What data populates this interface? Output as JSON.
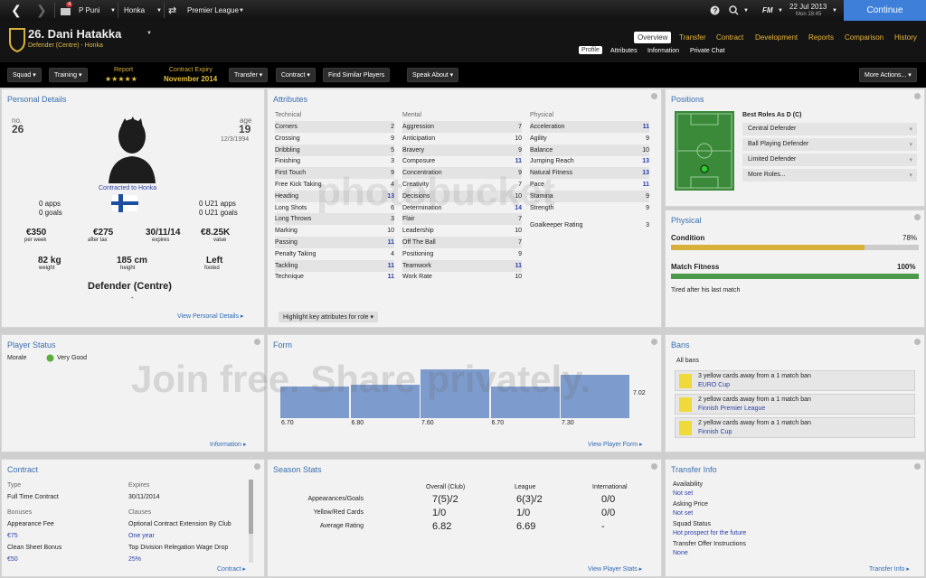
{
  "topbar": {
    "manager": "P Puni",
    "club": "Honka",
    "league": "Premier League",
    "date": "22 Jul 2013",
    "day_time": "Mon 18:45",
    "continue": "Continue",
    "badge": "4",
    "fm": "FM"
  },
  "player": {
    "name": "26. Dani Hatakka",
    "subtitle": "Defender (Centre) - Honka"
  },
  "nav": {
    "tabs": [
      "Overview",
      "Transfer",
      "Contract",
      "Development",
      "Reports",
      "Comparison",
      "History"
    ],
    "subtabs": [
      "Profile",
      "Attributes",
      "Information",
      "Private Chat"
    ]
  },
  "actions": {
    "squad": "Squad",
    "training": "Training",
    "report_label": "Report",
    "stars": "★★★★★",
    "contract_expiry_label": "Contract Expiry",
    "contract_expiry": "November 2014",
    "transfer": "Transfer",
    "contract": "Contract",
    "find_similar": "Find Similar Players",
    "speak_about": "Speak About",
    "more_actions": "More Actions..."
  },
  "personal": {
    "title": "Personal Details",
    "no_label": "no.",
    "no": "26",
    "age_label": "age",
    "age": "19",
    "dob": "12/3/1994",
    "contracted_to": "Contracted to Honka",
    "apps": "0 apps",
    "goals": "0 goals",
    "u21_apps": "0 U21 apps",
    "u21_goals": "0 U21 goals",
    "wage": "€350",
    "wage_label": "per week",
    "after_tax": "€275",
    "after_tax_label": "after tax",
    "expires": "30/11/14",
    "expires_label": "expires",
    "value": "€8.25K",
    "value_label": "value",
    "weight": "82 kg",
    "weight_label": "weight",
    "height": "185 cm",
    "height_label": "height",
    "foot": "Left",
    "foot_label": "footed",
    "position": "Defender (Centre)",
    "dash": "-",
    "link": "View Personal Details"
  },
  "attributes": {
    "title": "Attributes",
    "technical_label": "Technical",
    "mental_label": "Mental",
    "physical_label": "Physical",
    "technical": [
      [
        "Corners",
        "2"
      ],
      [
        "Crossing",
        "9"
      ],
      [
        "Dribbling",
        "5"
      ],
      [
        "Finishing",
        "3"
      ],
      [
        "First Touch",
        "9"
      ],
      [
        "Free Kick Taking",
        "4"
      ],
      [
        "Heading",
        "13"
      ],
      [
        "Long Shots",
        "6"
      ],
      [
        "Long Throws",
        "3"
      ],
      [
        "Marking",
        "10"
      ],
      [
        "Passing",
        "11"
      ],
      [
        "Penalty Taking",
        "4"
      ],
      [
        "Tackling",
        "11"
      ],
      [
        "Technique",
        "11"
      ]
    ],
    "mental": [
      [
        "Aggression",
        "7"
      ],
      [
        "Anticipation",
        "10"
      ],
      [
        "Bravery",
        "9"
      ],
      [
        "Composure",
        "11"
      ],
      [
        "Concentration",
        "9"
      ],
      [
        "Creativity",
        "7"
      ],
      [
        "Decisions",
        "10"
      ],
      [
        "Determination",
        "14"
      ],
      [
        "Flair",
        "7"
      ],
      [
        "Leadership",
        "10"
      ],
      [
        "Off The Ball",
        "7"
      ],
      [
        "Positioning",
        "9"
      ],
      [
        "Teamwork",
        "11"
      ],
      [
        "Work Rate",
        "10"
      ]
    ],
    "physical": [
      [
        "Acceleration",
        "11"
      ],
      [
        "Agility",
        "9"
      ],
      [
        "Balance",
        "10"
      ],
      [
        "Jumping Reach",
        "13"
      ],
      [
        "Natural Fitness",
        "13"
      ],
      [
        "Pace",
        "11"
      ],
      [
        "Stamina",
        "9"
      ],
      [
        "Strength",
        "9"
      ]
    ],
    "goalkeeper": [
      "Goalkeeper Rating",
      "3"
    ],
    "highlight": "Highlight key attributes for role"
  },
  "positions": {
    "title": "Positions",
    "best_roles": "Best Roles As D (C)",
    "roles": [
      "Central Defender",
      "Ball Playing Defender",
      "Limited Defender",
      "More Roles..."
    ]
  },
  "physical": {
    "title": "Physical",
    "condition_label": "Condition",
    "condition": "78%",
    "condition_fraction": 0.78,
    "fitness_label": "Match Fitness",
    "fitness": "100%",
    "fitness_fraction": 1.0,
    "note": "Tired after his last match"
  },
  "status": {
    "title": "Player Status",
    "morale_label": "Morale",
    "morale": "Very Good",
    "link": "Information"
  },
  "form": {
    "title": "Form",
    "avg": "7.02",
    "ratings": [
      "6.70",
      "6.80",
      "7.60",
      "6.70",
      "7.30"
    ],
    "values": [
      6.7,
      6.8,
      7.6,
      6.7,
      7.3
    ],
    "link": "View Player Form"
  },
  "bans": {
    "title": "Bans",
    "all_bans": "All bans",
    "items": [
      [
        "3 yellow cards away from a 1 match ban",
        "EURO Cup"
      ],
      [
        "2 yellow cards away from a 1 match ban",
        "Finnish Premier League"
      ],
      [
        "2 yellow cards away from a 1 match ban",
        "Finnish Cup"
      ]
    ]
  },
  "contract": {
    "title": "Contract",
    "type_label": "Type",
    "type": "Full Time Contract",
    "expires_label": "Expires",
    "expires": "30/11/2014",
    "bonuses_label": "Bonuses",
    "clauses_label": "Clauses",
    "bonuses": [
      [
        "Appearance Fee",
        "€75"
      ],
      [
        "Clean Sheet Bonus",
        "€50"
      ]
    ],
    "clauses": [
      [
        "Optional Contract Extension By Club",
        "One year"
      ],
      [
        "Top Division Relegation Wage Drop",
        "25%"
      ]
    ],
    "link": "Contract"
  },
  "season": {
    "title": "Season Stats",
    "cols": [
      "Overall (Club)",
      "League",
      "International"
    ],
    "rows": [
      [
        "Appearances/Goals",
        "7(5)/2",
        "6(3)/2",
        "0/0"
      ],
      [
        "Yellow/Red Cards",
        "1/0",
        "1/0",
        "0/0"
      ],
      [
        "Average Rating",
        "6.82",
        "6.69",
        "-"
      ]
    ],
    "link": "View Player Stats"
  },
  "transfer": {
    "title": "Transfer Info",
    "items": [
      [
        "Availability",
        "Not set"
      ],
      [
        "Asking Price",
        "Not set"
      ],
      [
        "Squad Status",
        "Hot prospect for the future"
      ],
      [
        "Transfer Offer Instructions",
        "None"
      ]
    ],
    "link": "Transfer Info"
  },
  "watermarks": {
    "w1": "photobucket",
    "w2": "Join free. Share privately."
  }
}
